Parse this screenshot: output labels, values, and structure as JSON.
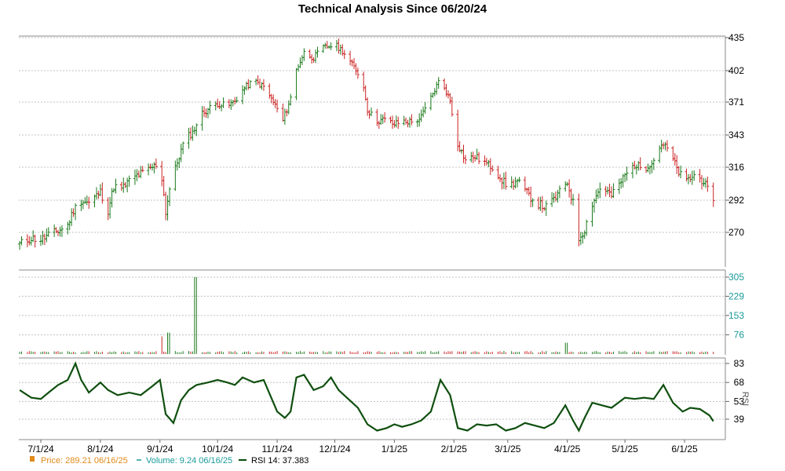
{
  "chart_data": {
    "type": "candlestick",
    "title": "Technical Analysis Since 06/20/24",
    "x_ticks": [
      "7/1/24",
      "8/1/24",
      "9/1/24",
      "10/1/24",
      "11/1/24",
      "12/1/24",
      "1/1/25",
      "2/1/25",
      "3/1/25",
      "4/1/25",
      "5/1/25",
      "6/1/25"
    ],
    "price": {
      "y_ticks": [
        270,
        292,
        316,
        343,
        371,
        402,
        435
      ],
      "series": [
        [
          "6/20/24",
          262
        ],
        [
          "6/26/24",
          266
        ],
        [
          "7/1/24",
          265
        ],
        [
          "7/5/24",
          268
        ],
        [
          "7/10/24",
          271
        ],
        [
          "7/15/24",
          275
        ],
        [
          "7/18/24",
          285
        ],
        [
          "7/22/24",
          292
        ],
        [
          "7/26/24",
          290
        ],
        [
          "8/1/24",
          298
        ],
        [
          "8/5/24",
          285
        ],
        [
          "8/8/24",
          302
        ],
        [
          "8/12/24",
          300
        ],
        [
          "8/16/24",
          306
        ],
        [
          "8/20/24",
          310
        ],
        [
          "8/26/24",
          314
        ],
        [
          "9/1/24",
          320
        ],
        [
          "9/4/24",
          284
        ],
        [
          "9/6/24",
          300
        ],
        [
          "9/10/24",
          320
        ],
        [
          "9/14/24",
          340
        ],
        [
          "9/18/24",
          345
        ],
        [
          "9/22/24",
          360
        ],
        [
          "9/26/24",
          365
        ],
        [
          "10/1/24",
          370
        ],
        [
          "10/6/24",
          367
        ],
        [
          "10/10/24",
          372
        ],
        [
          "10/15/24",
          385
        ],
        [
          "10/20/24",
          392
        ],
        [
          "10/25/24",
          386
        ],
        [
          "11/1/24",
          365
        ],
        [
          "11/4/24",
          355
        ],
        [
          "11/8/24",
          375
        ],
        [
          "11/11/24",
          403
        ],
        [
          "11/15/24",
          420
        ],
        [
          "11/20/24",
          415
        ],
        [
          "11/25/24",
          425
        ],
        [
          "12/1/24",
          428
        ],
        [
          "12/5/24",
          422
        ],
        [
          "12/10/24",
          408
        ],
        [
          "12/15/24",
          395
        ],
        [
          "12/18/24",
          365
        ],
        [
          "12/22/24",
          355
        ],
        [
          "12/27/24",
          356
        ],
        [
          "1/1/25",
          352
        ],
        [
          "1/5/25",
          355
        ],
        [
          "1/10/25",
          354
        ],
        [
          "1/15/25",
          358
        ],
        [
          "1/20/25",
          375
        ],
        [
          "1/25/25",
          395
        ],
        [
          "1/30/25",
          372
        ],
        [
          "2/1/25",
          352
        ],
        [
          "2/3/25",
          336
        ],
        [
          "2/7/25",
          322
        ],
        [
          "2/12/25",
          325
        ],
        [
          "2/17/25",
          320
        ],
        [
          "2/22/25",
          315
        ],
        [
          "2/27/25",
          305
        ],
        [
          "3/1/25",
          302
        ],
        [
          "3/6/25",
          306
        ],
        [
          "3/11/25",
          297
        ],
        [
          "3/16/25",
          290
        ],
        [
          "3/21/25",
          287
        ],
        [
          "3/26/25",
          294
        ],
        [
          "4/1/25",
          305
        ],
        [
          "4/4/25",
          290
        ],
        [
          "4/7/25",
          266
        ],
        [
          "4/10/25",
          272
        ],
        [
          "4/14/25",
          290
        ],
        [
          "4/19/25",
          303
        ],
        [
          "4/24/25",
          295
        ],
        [
          "5/1/25",
          310
        ],
        [
          "5/6/25",
          318
        ],
        [
          "5/11/25",
          315
        ],
        [
          "5/16/25",
          322
        ],
        [
          "5/20/25",
          336
        ],
        [
          "5/24/25",
          330
        ],
        [
          "5/28/25",
          315
        ],
        [
          "6/1/25",
          305
        ],
        [
          "6/6/25",
          310
        ],
        [
          "6/11/25",
          306
        ],
        [
          "6/16/25",
          289
        ]
      ]
    },
    "volume": {
      "y_ticks": [
        76,
        153,
        229,
        305
      ],
      "spikes": [
        [
          "9/1/24",
          70
        ],
        [
          "9/6/24",
          85
        ],
        [
          "9/20/24",
          305
        ],
        [
          "3/31/25",
          45
        ]
      ]
    },
    "rsi": {
      "y_ticks": [
        39,
        53,
        68,
        83
      ],
      "series": [
        [
          "6/20/24",
          62
        ],
        [
          "6/26/24",
          56
        ],
        [
          "7/1/24",
          55
        ],
        [
          "7/5/24",
          60
        ],
        [
          "7/10/24",
          66
        ],
        [
          "7/15/24",
          70
        ],
        [
          "7/19/24",
          83
        ],
        [
          "7/22/24",
          70
        ],
        [
          "7/26/24",
          60
        ],
        [
          "8/1/24",
          68
        ],
        [
          "8/5/24",
          62
        ],
        [
          "8/10/24",
          58
        ],
        [
          "8/16/24",
          60
        ],
        [
          "8/22/24",
          58
        ],
        [
          "8/28/24",
          65
        ],
        [
          "9/1/24",
          70
        ],
        [
          "9/4/24",
          43
        ],
        [
          "9/8/24",
          36
        ],
        [
          "9/12/24",
          54
        ],
        [
          "9/16/24",
          62
        ],
        [
          "9/20/24",
          66
        ],
        [
          "9/26/24",
          68
        ],
        [
          "10/1/24",
          70
        ],
        [
          "10/6/24",
          68
        ],
        [
          "10/10/24",
          66
        ],
        [
          "10/14/24",
          72
        ],
        [
          "10/20/24",
          68
        ],
        [
          "10/25/24",
          70
        ],
        [
          "11/1/24",
          45
        ],
        [
          "11/5/24",
          40
        ],
        [
          "11/8/24",
          45
        ],
        [
          "11/11/24",
          72
        ],
        [
          "11/15/24",
          74
        ],
        [
          "11/20/24",
          62
        ],
        [
          "11/25/24",
          65
        ],
        [
          "11/29/24",
          72
        ],
        [
          "12/3/24",
          62
        ],
        [
          "12/8/24",
          55
        ],
        [
          "12/13/24",
          48
        ],
        [
          "12/18/24",
          35
        ],
        [
          "12/23/24",
          30
        ],
        [
          "12/28/24",
          32
        ],
        [
          "1/1/25",
          35
        ],
        [
          "1/5/25",
          33
        ],
        [
          "1/10/25",
          35
        ],
        [
          "1/15/25",
          38
        ],
        [
          "1/20/25",
          45
        ],
        [
          "1/25/25",
          70
        ],
        [
          "1/30/25",
          58
        ],
        [
          "2/3/25",
          32
        ],
        [
          "2/8/25",
          30
        ],
        [
          "2/13/25",
          35
        ],
        [
          "2/18/25",
          34
        ],
        [
          "2/23/25",
          35
        ],
        [
          "2/28/25",
          30
        ],
        [
          "3/5/25",
          32
        ],
        [
          "3/10/25",
          36
        ],
        [
          "3/15/25",
          34
        ],
        [
          "3/20/25",
          32
        ],
        [
          "3/25/25",
          36
        ],
        [
          "3/31/25",
          50
        ],
        [
          "4/4/25",
          38
        ],
        [
          "4/7/25",
          30
        ],
        [
          "4/10/25",
          40
        ],
        [
          "4/14/25",
          52
        ],
        [
          "4/19/25",
          50
        ],
        [
          "4/24/25",
          48
        ],
        [
          "5/1/25",
          56
        ],
        [
          "5/6/25",
          55
        ],
        [
          "5/11/25",
          56
        ],
        [
          "5/16/25",
          55
        ],
        [
          "5/21/25",
          66
        ],
        [
          "5/26/25",
          52
        ],
        [
          "5/31/25",
          45
        ],
        [
          "6/4/25",
          48
        ],
        [
          "6/9/25",
          47
        ],
        [
          "6/14/25",
          42
        ],
        [
          "6/16/25",
          37.383
        ]
      ]
    }
  },
  "legend": {
    "price": "Price: 289.21  06/16/25",
    "volume": "Volume: 9.24  06/16/25",
    "rsi": "RSI 14: 37.383"
  },
  "rsi_axis_label": "RSI",
  "colors": {
    "up": "#1a7a1a",
    "down": "#cc2222",
    "rsi_line": "#0f4f0f",
    "price_legend": "#e08a1a",
    "volume_legend": "#1a9a9a",
    "grid": "#c0c0c0"
  }
}
